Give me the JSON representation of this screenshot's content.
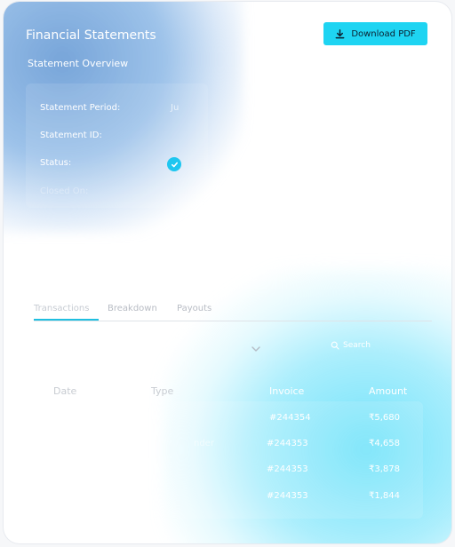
{
  "header": {
    "title": "Financial Statements",
    "download_label": "Download PDF"
  },
  "overview": {
    "title": "Statement Overview",
    "rows": [
      {
        "label": "Statement Period:",
        "value": "Ju"
      },
      {
        "label": "Statement ID:",
        "value": ""
      },
      {
        "label": "Status:",
        "value": ""
      },
      {
        "label": "Closed On:",
        "value": ""
      }
    ]
  },
  "tabs": [
    {
      "label": "Transactions",
      "active": true
    },
    {
      "label": "Breakdown",
      "active": false
    },
    {
      "label": "Payouts",
      "active": false
    }
  ],
  "filters": {
    "search_placeholder": "Search"
  },
  "table": {
    "headers": [
      "Date",
      "Type",
      "Invoice",
      "Amount"
    ],
    "rows": [
      {
        "type": "",
        "invoice": "#244354",
        "amount": "₹5,680"
      },
      {
        "type": "nder",
        "invoice": "#244353",
        "amount": "₹4,658"
      },
      {
        "type": "",
        "invoice": "#244353",
        "amount": "₹3,878"
      },
      {
        "type": "",
        "invoice": "#244353",
        "amount": "₹1,844"
      }
    ]
  },
  "icons": {
    "download": "download-icon",
    "status": "check-circle-icon",
    "dropdown": "chevron-down-icon",
    "search": "search-icon"
  },
  "colors": {
    "accent": "#1ed4f2",
    "status_ok": "#1ec6f0",
    "tab_underline": "#20bfe0"
  }
}
